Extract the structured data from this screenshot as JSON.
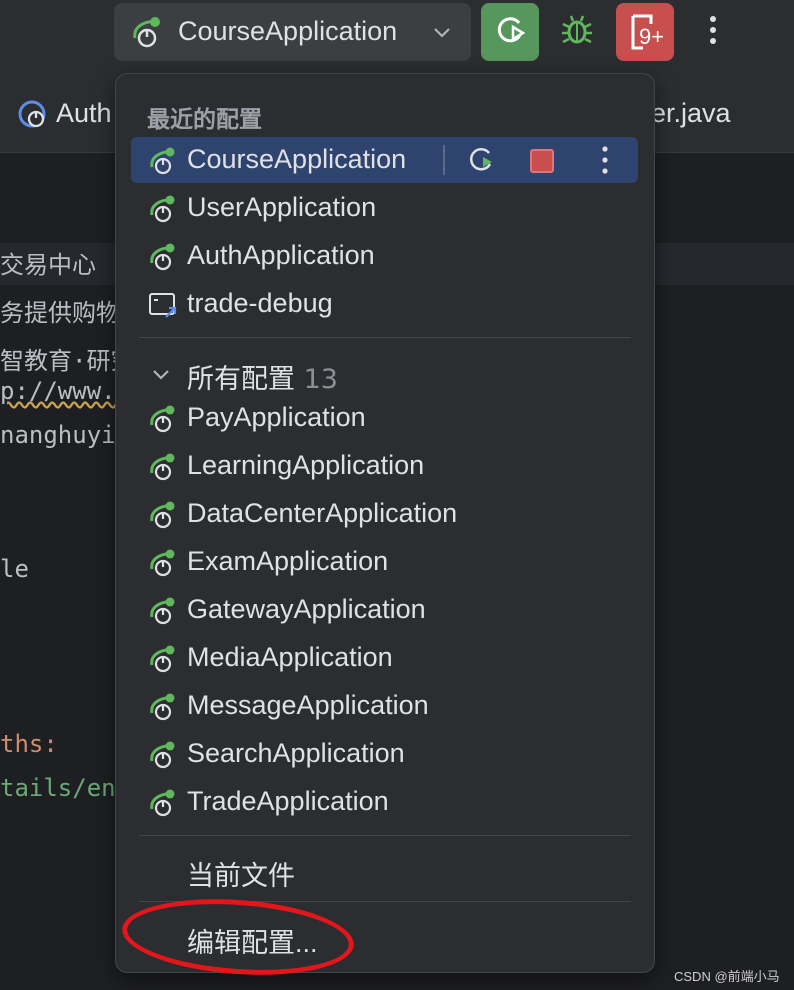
{
  "toolbar": {
    "selected_config": "CourseApplication",
    "profile_badge": "9+",
    "accent_run": "#57965c",
    "accent_profile": "#c94f4f"
  },
  "tabs": {
    "left_tab": "Auth",
    "right_tab": "er.java"
  },
  "editor": {
    "lines": [
      "交易中心",
      "务提供购物",
      "智教育·研究",
      "p://www.",
      "nanghuyi",
      "le",
      "ths:",
      "tails/en"
    ]
  },
  "menu": {
    "recent_header": "最近的配置",
    "recent": [
      {
        "label": "CourseApplication",
        "icon": "spring-boot-icon",
        "selected": true
      },
      {
        "label": "UserApplication",
        "icon": "spring-boot-icon"
      },
      {
        "label": "AuthApplication",
        "icon": "spring-boot-icon"
      },
      {
        "label": "trade-debug",
        "icon": "remote-debug-icon"
      }
    ],
    "all_header": "所有配置",
    "all_count": "13",
    "all": [
      {
        "label": "PayApplication"
      },
      {
        "label": "LearningApplication"
      },
      {
        "label": "DataCenterApplication"
      },
      {
        "label": "ExamApplication"
      },
      {
        "label": "GatewayApplication"
      },
      {
        "label": "MediaApplication"
      },
      {
        "label": "MessageApplication"
      },
      {
        "label": "SearchApplication"
      },
      {
        "label": "TradeApplication"
      }
    ],
    "current_file": "当前文件",
    "edit_configs": "编辑配置..."
  },
  "watermark": "CSDN @前端小马",
  "colors": {
    "selection": "#2e436e",
    "annotation": "#e3161c",
    "spring_green": "#5fb85c"
  }
}
